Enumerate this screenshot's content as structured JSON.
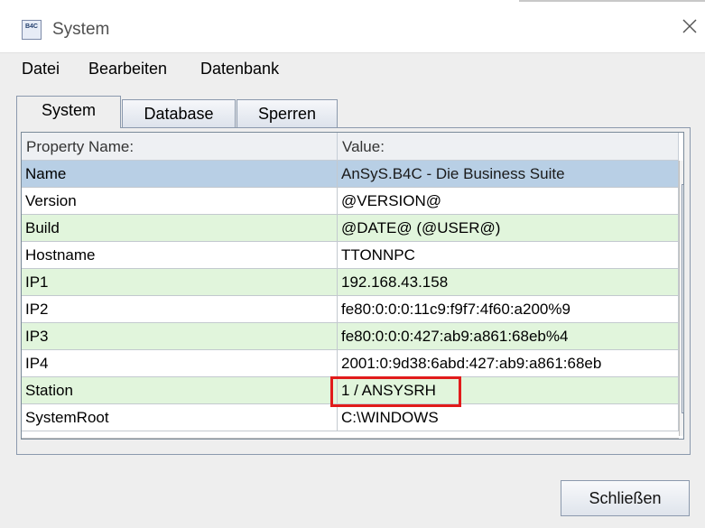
{
  "window": {
    "title": "System",
    "icon_label": "B4C"
  },
  "menu": {
    "items": [
      "Datei",
      "Bearbeiten",
      "Datenbank"
    ]
  },
  "tabs": [
    {
      "label": "System",
      "active": true
    },
    {
      "label": "Database",
      "active": false
    },
    {
      "label": "Sperren",
      "active": false
    }
  ],
  "table": {
    "headers": [
      "Property Name:",
      "Value:"
    ],
    "selected_index": 0,
    "rows": [
      {
        "name": "Name",
        "value": "AnSyS.B4C - Die Business Suite"
      },
      {
        "name": "Version",
        "value": "@VERSION@"
      },
      {
        "name": "Build",
        "value": "@DATE@ (@USER@)"
      },
      {
        "name": "Hostname",
        "value": "TTONNPC"
      },
      {
        "name": "IP1",
        "value": "192.168.43.158"
      },
      {
        "name": "IP2",
        "value": "fe80:0:0:0:11c9:f9f7:4f60:a200%9"
      },
      {
        "name": "IP3",
        "value": "fe80:0:0:0:427:ab9:a861:68eb%4"
      },
      {
        "name": "IP4",
        "value": "2001:0:9d38:6abd:427:ab9:a861:68eb"
      },
      {
        "name": "Station",
        "value": "1 / ANSYSRH"
      },
      {
        "name": "SystemRoot",
        "value": "C:\\WINDOWS"
      }
    ]
  },
  "highlighted_row": "Station",
  "buttons": {
    "close": "Schließen"
  },
  "colors": {
    "selected_row": "#b8cfe5",
    "even_row": "#e1f5dc",
    "odd_row": "#ffffff",
    "highlight": "#e11b1b"
  }
}
